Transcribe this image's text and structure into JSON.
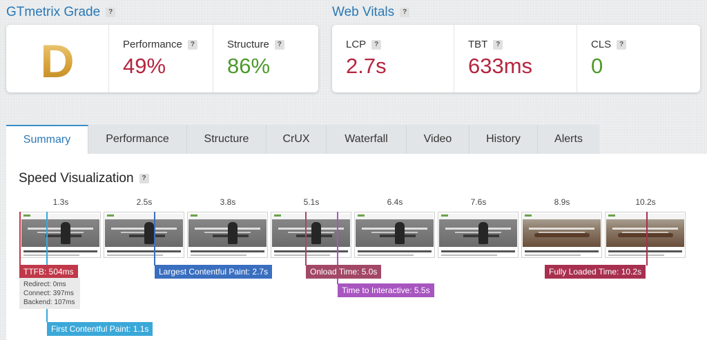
{
  "grade_section": {
    "title": "GTmetrix Grade",
    "grade": "D",
    "performance_label": "Performance",
    "performance_value": "49%",
    "structure_label": "Structure",
    "structure_value": "86%"
  },
  "vitals_section": {
    "title": "Web Vitals",
    "lcp_label": "LCP",
    "lcp_value": "2.7s",
    "tbt_label": "TBT",
    "tbt_value": "633ms",
    "cls_label": "CLS",
    "cls_value": "0"
  },
  "help_glyph": "?",
  "colors": {
    "bad": "#b5253f",
    "good": "#4c9a2a",
    "accent": "#2a78b5",
    "grade_gold": "#d9a43c"
  },
  "tabs": [
    "Summary",
    "Performance",
    "Structure",
    "CrUX",
    "Waterfall",
    "Video",
    "History",
    "Alerts"
  ],
  "active_tab": "Summary",
  "speed": {
    "title": "Speed Visualization",
    "timestamps": [
      "1.3s",
      "2.5s",
      "3.8s",
      "5.1s",
      "6.4s",
      "7.6s",
      "8.9s",
      "10.2s"
    ],
    "frame_content": {
      "screenshot_icons": [
        "person-at-desk",
        "person-at-desk",
        "person-at-desk",
        "person-at-desk",
        "person-at-desk",
        "person-at-desk",
        "conference-room",
        "conference-room"
      ]
    },
    "markers": {
      "ttfb": "TTFB: 504ms",
      "redirect": "Redirect: 0ms",
      "connect": "Connect: 397ms",
      "backend": "Backend: 107ms",
      "fcp": "First Contentful Paint: 1.1s",
      "lcp": "Largest Contentful Paint: 2.7s",
      "onload": "Onload Time: 5.0s",
      "tti": "Time to Interactive: 5.5s",
      "fully_loaded": "Fully Loaded Time: 10.2s"
    },
    "marker_colors": {
      "ttfb": "#c0394a",
      "fcp": "#3aa8d8",
      "lcp": "#3a6fc0",
      "onload": "#a24866",
      "tti": "#a855c0",
      "fully_loaded": "#a8304f"
    }
  }
}
